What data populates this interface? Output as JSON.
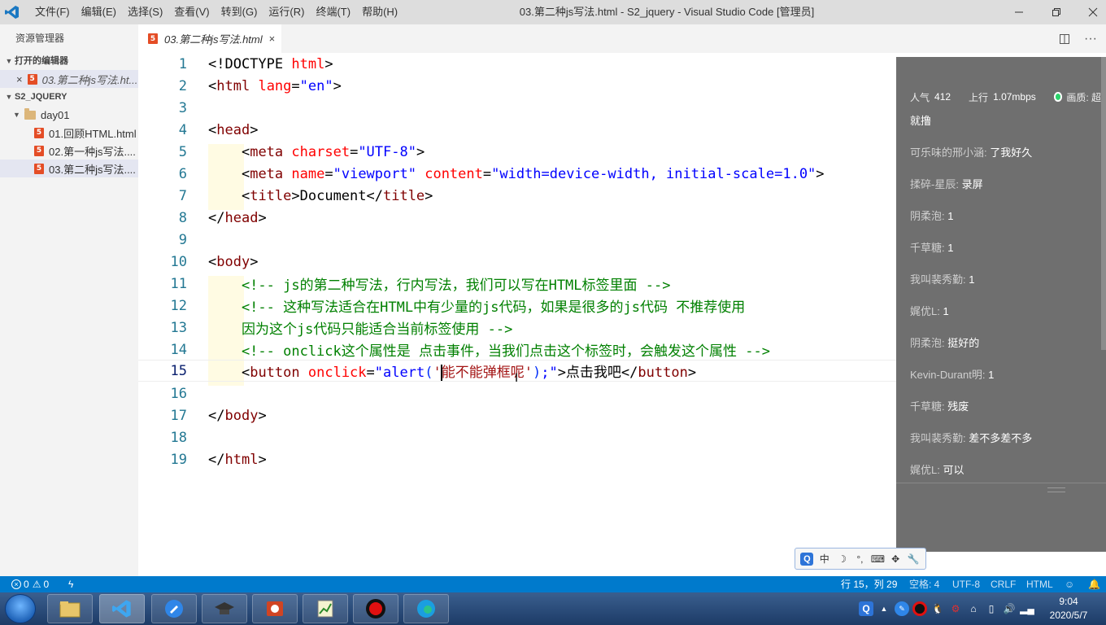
{
  "window": {
    "title": "03.第二种js写法.html - S2_jquery - Visual Studio Code [管理员]",
    "menu": [
      "文件(F)",
      "编辑(E)",
      "选择(S)",
      "查看(V)",
      "转到(G)",
      "运行(R)",
      "终端(T)",
      "帮助(H)"
    ]
  },
  "sidebar": {
    "title": "资源管理器",
    "open_editors_header": "打开的编辑器",
    "open_editor_file": "03.第二种js写法.ht...",
    "project_header": "S2_JQUERY",
    "folder": "day01",
    "files": [
      "01.回顾HTML.html",
      "02.第一种js写法....",
      "03.第二种js写法...."
    ]
  },
  "tab": {
    "label": "03.第二种js写法.html"
  },
  "editor": {
    "line_numbers": [
      "1",
      "2",
      "3",
      "4",
      "5",
      "6",
      "7",
      "8",
      "9",
      "10",
      "11",
      "12",
      "13",
      "14",
      "15",
      "16",
      "17",
      "18",
      "19"
    ],
    "current_line": 15
  },
  "overlay": {
    "stats": {
      "popularity_label": "人气",
      "popularity_value": "412",
      "upload_label": "上行",
      "upload_value": "1.07mbps",
      "quality_label": "画质: 超"
    },
    "first_message": "就撸",
    "messages": [
      {
        "user": "可乐味的邢小涵:",
        "text": "了我好久"
      },
      {
        "user": "揉碎-星辰:",
        "text": "录屏"
      },
      {
        "user": "阴柔泡:",
        "text": "1"
      },
      {
        "user": "千草糖:",
        "text": "1"
      },
      {
        "user": "我叫裴秀勤:",
        "text": "1"
      },
      {
        "user": "娓优L:",
        "text": "1"
      },
      {
        "user": "阴柔泡:",
        "text": "挺好的"
      },
      {
        "user": "Kevin-Durant明:",
        "text": "1"
      },
      {
        "user": "千草糖:",
        "text": "残废"
      },
      {
        "user": "我叫裴秀勤:",
        "text": "差不多差不多"
      },
      {
        "user": "娓优L:",
        "text": "可以"
      }
    ]
  },
  "ime": {
    "mode": "中"
  },
  "statusbar": {
    "errors": "0",
    "warnings": "0",
    "position": "行 15，列 29",
    "indent": "空格: 4",
    "encoding": "UTF-8",
    "eol": "CRLF",
    "language": "HTML"
  },
  "taskbar": {
    "time": "9:04",
    "date": "2020/5/7"
  },
  "colors": {
    "statusbar": "#007acc",
    "titlebar": "#dddddd",
    "tag": "#800000",
    "attribute": "#ff0000",
    "attr_value": "#0000ff",
    "comment": "#008000",
    "line_number": "#237893"
  }
}
